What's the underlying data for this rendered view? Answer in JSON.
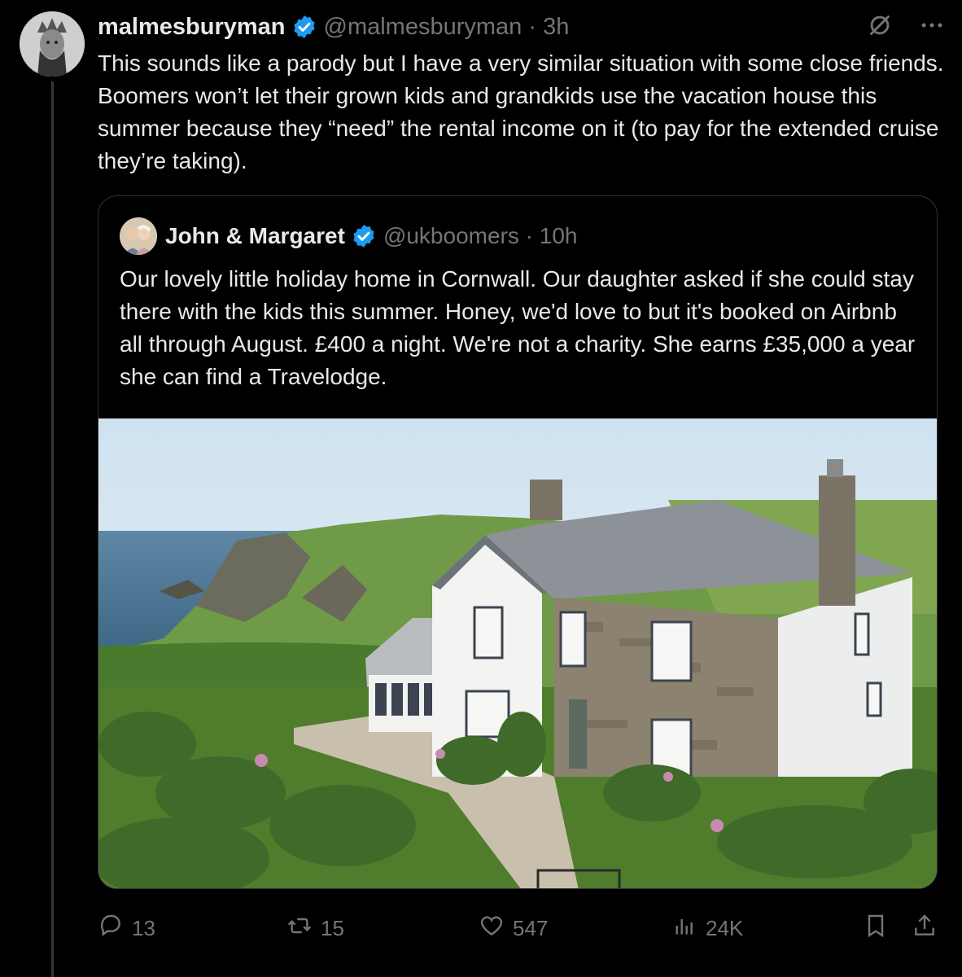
{
  "post": {
    "display_name": "malmesburyman",
    "handle": "@malmesburyman",
    "separator": " · ",
    "time": "3h",
    "text": "This sounds like a parody but I have a very similar situation with some close friends. Boomers won’t let their grown kids and grandkids use the vacation house this summer because they “need” the rental income on it (to pay for the extended cruise they’re taking)."
  },
  "quote": {
    "display_name": "John & Margaret",
    "handle": "@ukboomers",
    "separator": " · ",
    "time": "10h",
    "text": "Our lovely little holiday home in Cornwall. Our daughter asked if she could stay there with the kids this summer. Honey, we'd love to but it's booked on Airbnb all through August. £400 a night. We're not a charity. She earns £35,000 a year she can find a Travelodge."
  },
  "metrics": {
    "replies": "13",
    "reposts": "15",
    "likes": "547",
    "views": "24K"
  },
  "icons": {
    "verified": "verified-badge-icon",
    "grok": "grok-icon",
    "more": "more-icon",
    "reply": "reply-icon",
    "repost": "repost-icon",
    "like": "like-icon",
    "views": "views-icon",
    "bookmark": "bookmark-icon",
    "share": "share-icon"
  },
  "colors": {
    "background": "#000000",
    "text": "#e7e9ea",
    "muted": "#71767b",
    "verified": "#1d9bf0",
    "border": "#2f3336"
  }
}
